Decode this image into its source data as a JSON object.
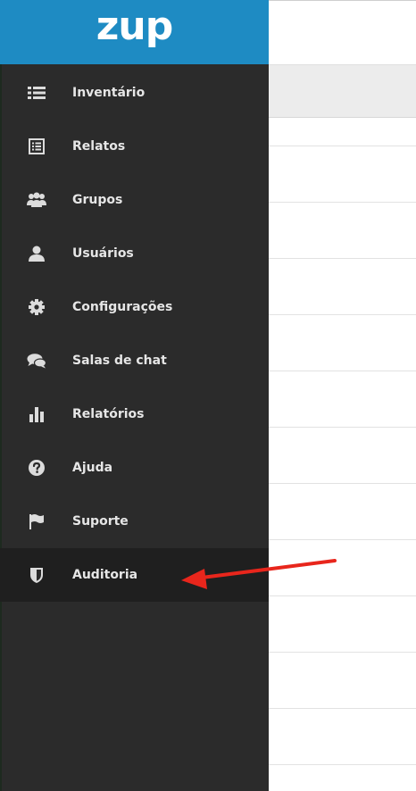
{
  "brand": {
    "logo_text": "zup",
    "color": "#1e8bc3"
  },
  "sidebar": {
    "background": "#2b2b2b",
    "active_background": "#1f1f1f",
    "items": [
      {
        "label": "Inventário",
        "icon": "list-icon"
      },
      {
        "label": "Relatos",
        "icon": "document-list-icon"
      },
      {
        "label": "Grupos",
        "icon": "users-group-icon"
      },
      {
        "label": "Usuários",
        "icon": "user-icon"
      },
      {
        "label": "Configurações",
        "icon": "gear-icon"
      },
      {
        "label": "Salas de chat",
        "icon": "chat-bubbles-icon"
      },
      {
        "label": "Relatórios",
        "icon": "bar-chart-icon"
      },
      {
        "label": "Ajuda",
        "icon": "question-circle-icon"
      },
      {
        "label": "Suporte",
        "icon": "flag-icon"
      },
      {
        "label": "Auditoria",
        "icon": "shield-icon",
        "active": true
      }
    ]
  },
  "annotation": {
    "type": "red-arrow",
    "target": "Auditoria",
    "color": "#e8261c"
  }
}
